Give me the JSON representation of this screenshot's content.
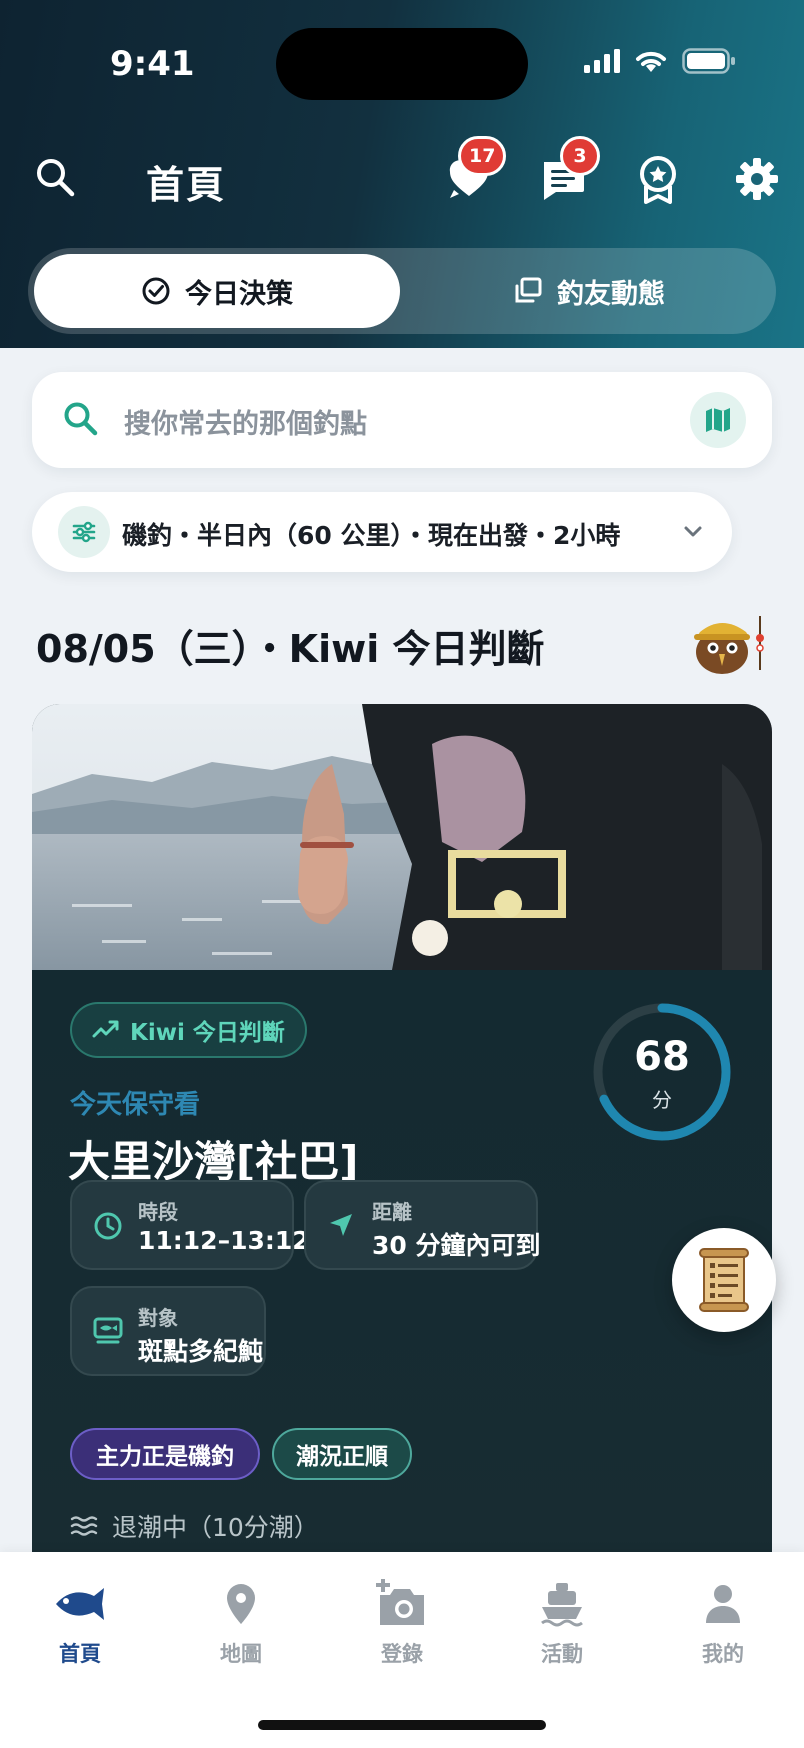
{
  "status_bar": {
    "time": "9:41"
  },
  "header": {
    "title": "首頁",
    "badges": {
      "favorites": "17",
      "messages": "3"
    }
  },
  "segment": {
    "active_label": "今日決策",
    "inactive_label": "釣友動態"
  },
  "search": {
    "placeholder": "搜你常去的那個釣點"
  },
  "filter": {
    "summary": "磯釣・半日內（60 公里）・現在出發・2小時"
  },
  "section": {
    "title": "08/05（三）・Kiwi 今日判斷"
  },
  "card": {
    "pill_label": "Kiwi 今日判斷",
    "recommendation": "今天保守看",
    "spot_name": "大里沙灣[社巴]",
    "score": {
      "value": "68",
      "unit": "分",
      "fraction": 0.68
    },
    "chips": {
      "time": {
        "label": "時段",
        "value": "11:12–13:12"
      },
      "distance": {
        "label": "距離",
        "value": "30 分鐘內可到"
      },
      "target": {
        "label": "對象",
        "value": "斑點多紀魨"
      }
    },
    "tags": [
      "主力正是磯釣",
      "潮況正順"
    ],
    "tide": "退潮中（10分潮）"
  },
  "nav": {
    "items": [
      {
        "label": "首頁",
        "icon": "fish-icon"
      },
      {
        "label": "地圖",
        "icon": "map-pin-icon"
      },
      {
        "label": "登錄",
        "icon": "camera-add-icon"
      },
      {
        "label": "活動",
        "icon": "boat-icon"
      },
      {
        "label": "我的",
        "icon": "person-icon"
      }
    ]
  },
  "colors": {
    "accent_teal": "#2eb89b",
    "score_ring": "#1f87b0",
    "badge_red": "#e03b35",
    "nav_active": "#1f4a8c"
  }
}
